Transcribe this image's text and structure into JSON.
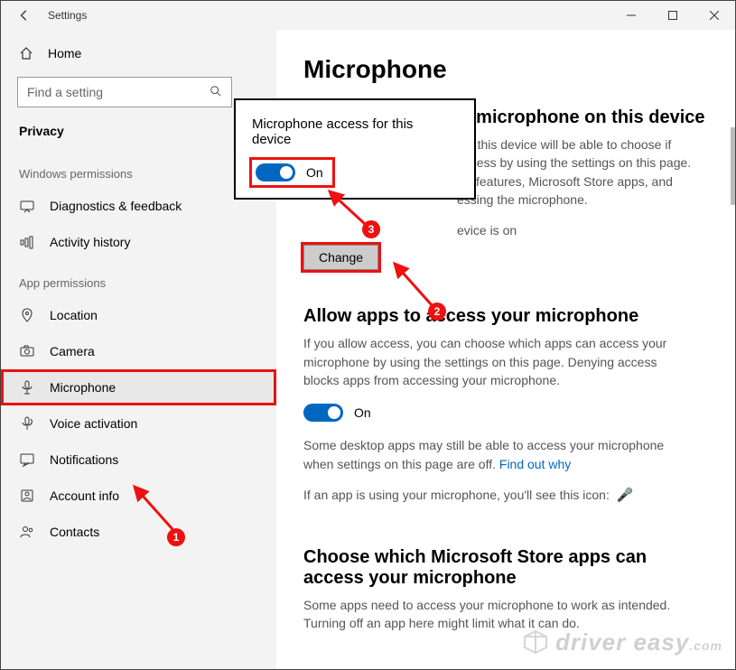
{
  "titlebar": {
    "title": "Settings"
  },
  "sidebar": {
    "home": "Home",
    "search_placeholder": "Find a setting",
    "category": "Privacy",
    "group1_label": "Windows permissions",
    "group2_label": "App permissions",
    "items_win": [
      {
        "label": "Diagnostics & feedback"
      },
      {
        "label": "Activity history"
      }
    ],
    "items_app": [
      {
        "label": "Location"
      },
      {
        "label": "Camera"
      },
      {
        "label": "Microphone"
      },
      {
        "label": "Voice activation"
      },
      {
        "label": "Notifications"
      },
      {
        "label": "Account info"
      },
      {
        "label": "Contacts"
      }
    ]
  },
  "main": {
    "page_title": "Microphone",
    "section1_title_partial": "microphone on this device",
    "section1_body_partial": "ing this device will be able to choose if access by using the settings on this page. ws features, Microsoft Store apps, and essing the microphone.",
    "status_line_partial": "evice is on",
    "change_btn": "Change",
    "section2_title": "Allow apps to access your microphone",
    "section2_body": "If you allow access, you can choose which apps can access your microphone by using the settings on this page. Denying access blocks apps from accessing your microphone.",
    "toggle_on_label": "On",
    "desktop_note_a": "Some desktop apps may still be able to access your microphone when settings on this page are off. ",
    "desktop_link": "Find out why",
    "icon_note": "If an app is using your microphone, you'll see this icon:",
    "section3_title": "Choose which Microsoft Store apps can access your microphone",
    "section3_body": "Some apps need to access your microphone to work as intended. Turning off an app here might limit what it can do."
  },
  "popup": {
    "title": "Microphone access for this device",
    "toggle_label": "On"
  },
  "annotations": {
    "n1": "1",
    "n2": "2",
    "n3": "3"
  },
  "watermark": {
    "text": "driver easy",
    "sub": ".com"
  }
}
